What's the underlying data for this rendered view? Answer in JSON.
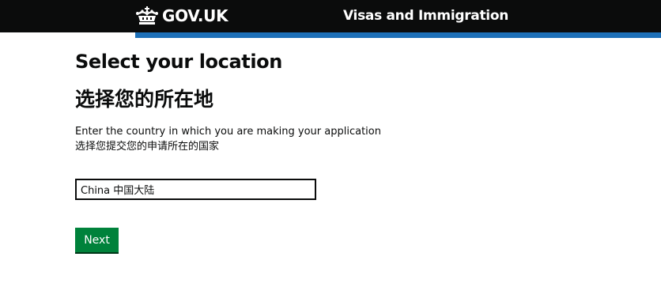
{
  "header": {
    "logo_text": "GOV.UK",
    "service_name": "Visas and Immigration",
    "colors": {
      "background": "#0b0c0c",
      "stripe": "#1d70b8"
    },
    "logo_icon": "crown-icon"
  },
  "main": {
    "title_en": "Select your location",
    "title_zh": "选择您的所在地",
    "hint_en": "Enter the country in which you are making your application",
    "hint_zh": "选择您提交您的申请所在的国家",
    "country_field": {
      "value": "China 中国大陆"
    },
    "next_button": {
      "label": "Next",
      "color": "#00823b"
    }
  }
}
